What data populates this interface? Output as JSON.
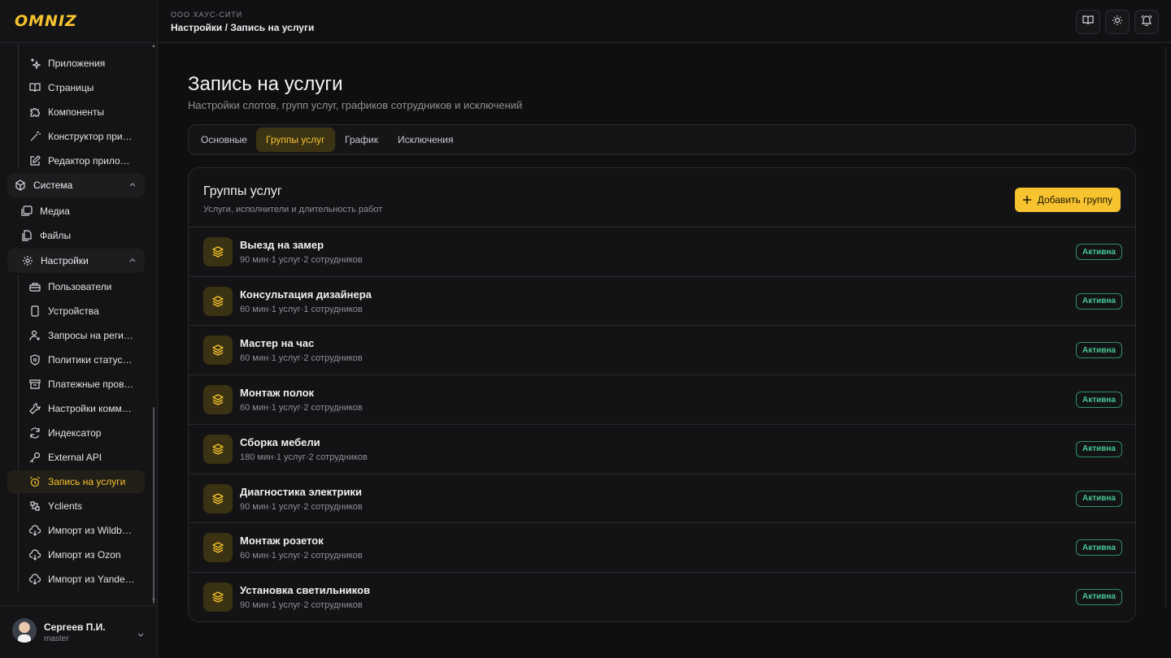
{
  "app": {
    "logo": "OMNIZ"
  },
  "header": {
    "org": "ООО ХАУС-СИТИ",
    "breadcrumb": "Настройки / Запись на услуги"
  },
  "sidebar": {
    "top_items": [
      {
        "label": "Приложения",
        "icon": "sparkles-icon"
      },
      {
        "label": "Страницы",
        "icon": "book-open-icon"
      },
      {
        "label": "Компоненты",
        "icon": "puzzle-icon"
      },
      {
        "label": "Конструктор прил...",
        "icon": "wand-icon"
      },
      {
        "label": "Редактор приложе...",
        "icon": "edit-icon"
      }
    ],
    "group_system": {
      "label": "Система",
      "icon": "cube-icon"
    },
    "system_items": [
      {
        "label": "Медиа",
        "icon": "images-icon"
      },
      {
        "label": "Файлы",
        "icon": "files-icon"
      }
    ],
    "group_settings": {
      "label": "Настройки",
      "icon": "gear-icon"
    },
    "settings_items": [
      {
        "label": "Пользователи",
        "icon": "users-icon"
      },
      {
        "label": "Устройства",
        "icon": "phone-icon"
      },
      {
        "label": "Запросы на регист...",
        "icon": "user-plus-icon"
      },
      {
        "label": "Политики статусов...",
        "icon": "shield-icon"
      },
      {
        "label": "Платежные провай...",
        "icon": "archive-icon"
      },
      {
        "label": "Настройки коммер...",
        "icon": "wrench-icon"
      },
      {
        "label": "Индексатор",
        "icon": "refresh-icon"
      },
      {
        "label": "External API",
        "icon": "key-icon"
      },
      {
        "label": "Запись на услуги",
        "icon": "alarm-icon",
        "active": true
      },
      {
        "label": "Yclients",
        "icon": "tools-icon"
      },
      {
        "label": "Импорт из Wildber...",
        "icon": "cloud-download-icon"
      },
      {
        "label": "Импорт из Ozon",
        "icon": "cloud-download-icon"
      },
      {
        "label": "Импорт из Yandex ...",
        "icon": "cloud-download-icon"
      }
    ],
    "user": {
      "name": "Сергеев П.И.",
      "role": "master"
    }
  },
  "page": {
    "title": "Запись на услуги",
    "subtitle": "Настройки слотов, групп услуг, графиков сотрудников и исключений",
    "tabs": [
      "Основные",
      "Группы услуг",
      "График",
      "Исключения"
    ],
    "active_tab": "Группы услуг"
  },
  "card": {
    "title": "Группы услуг",
    "subtitle": "Услуги, исполнители и длительность работ",
    "add_button": "Добавить группу",
    "groups": [
      {
        "name": "Выезд на замер",
        "meta": "90 мин·1 услуг·2 сотрудников",
        "status": "Активна"
      },
      {
        "name": "Консультация дизайнера",
        "meta": "60 мин·1 услуг·1 сотрудников",
        "status": "Активна"
      },
      {
        "name": "Мастер на час",
        "meta": "60 мин·1 услуг·2 сотрудников",
        "status": "Активна"
      },
      {
        "name": "Монтаж полок",
        "meta": "60 мин·1 услуг·2 сотрудников",
        "status": "Активна"
      },
      {
        "name": "Сборка мебели",
        "meta": "180 мин·1 услуг·2 сотрудников",
        "status": "Активна"
      },
      {
        "name": "Диагностика электрики",
        "meta": "90 мин·1 услуг·2 сотрудников",
        "status": "Активна"
      },
      {
        "name": "Монтаж розеток",
        "meta": "60 мин·1 услуг·2 сотрудников",
        "status": "Активна"
      },
      {
        "name": "Установка светильников",
        "meta": "90 мин·1 услуг·2 сотрудников",
        "status": "Активна"
      }
    ]
  },
  "colors": {
    "accent": "#f7c32e",
    "status_active": "#47c792",
    "background": "#0f0f10"
  }
}
